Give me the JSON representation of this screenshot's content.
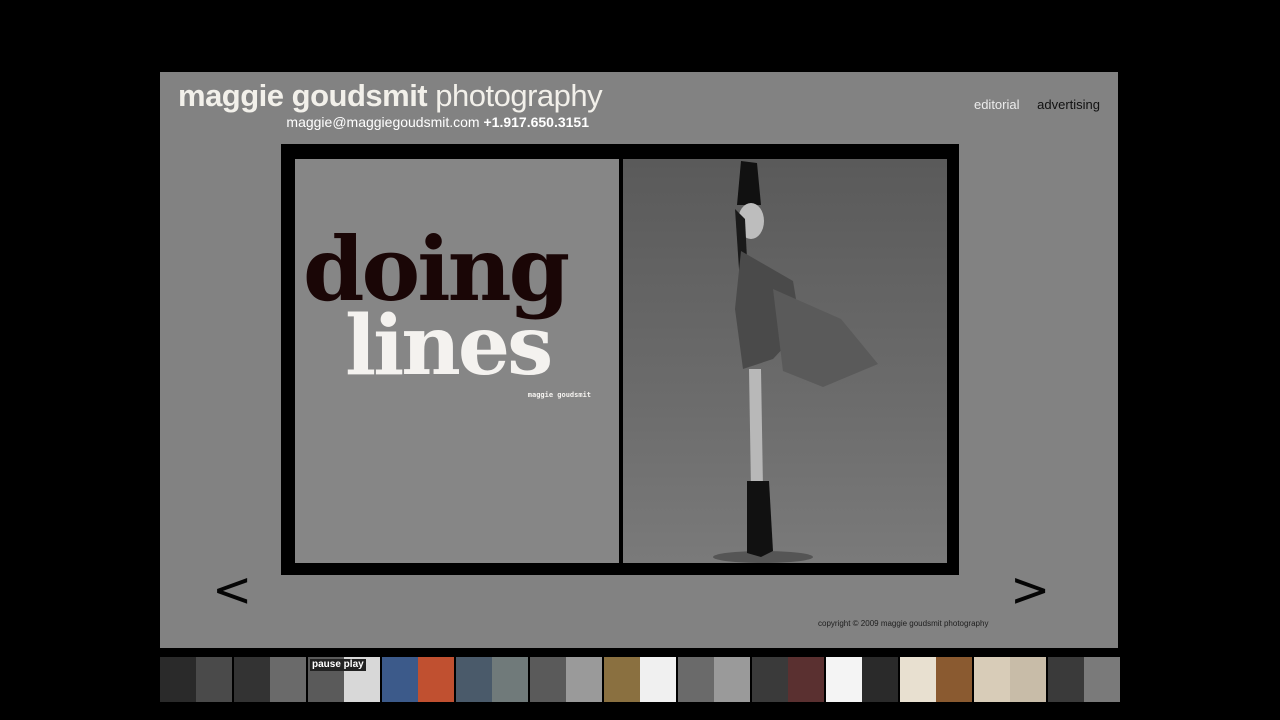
{
  "header": {
    "brand_first": "maggie goudsmit",
    "brand_second": "photography",
    "email": "maggie@maggiegoudsmit.com",
    "phone": "+1.917.650.3151"
  },
  "nav": {
    "editorial": "editorial",
    "advertising": "advertising"
  },
  "spread": {
    "title_line1": "doing",
    "title_line2": "lines",
    "credit": "maggie goudsmit"
  },
  "controls": {
    "prev": "<",
    "next": ">"
  },
  "copyright": "copyright  ©  2009 maggie goudsmit photography",
  "thumbnails": [
    {
      "colors": [
        "#2a2a2a",
        "#4a4a4a"
      ]
    },
    {
      "colors": [
        "#333333",
        "#6a6a6a"
      ]
    },
    {
      "colors": [
        "#5a5a5a",
        "#d8d8d8"
      ],
      "label": "pause play"
    },
    {
      "colors": [
        "#3c5a8a",
        "#c05030"
      ]
    },
    {
      "colors": [
        "#4a5a6a",
        "#707a7a"
      ]
    },
    {
      "colors": [
        "#5a5a5a",
        "#9a9a9a"
      ]
    },
    {
      "colors": [
        "#8a7040",
        "#f0f0f0"
      ]
    },
    {
      "colors": [
        "#6a6a6a",
        "#9a9a9a"
      ]
    },
    {
      "colors": [
        "#3a3a3a",
        "#5a3030"
      ]
    },
    {
      "colors": [
        "#f4f4f4",
        "#2a2a2a"
      ]
    },
    {
      "colors": [
        "#e8e0d0",
        "#8a5a30"
      ]
    },
    {
      "colors": [
        "#d8ccb8",
        "#c8bca8"
      ]
    },
    {
      "colors": [
        "#3a3a3a",
        "#7a7a7a"
      ]
    }
  ]
}
